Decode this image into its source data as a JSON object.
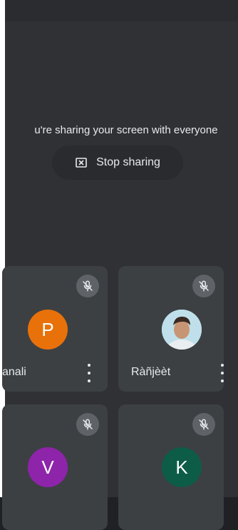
{
  "share_banner": {
    "message": "u're sharing your screen with everyone",
    "stop_button_label": "Stop sharing",
    "stop_icon": "close-box-icon"
  },
  "participants": [
    {
      "name": "anali",
      "initial": "P",
      "avatar_color": "#e8710a",
      "muted": true
    },
    {
      "name": "Ràñjèèt",
      "initial": "",
      "avatar_type": "photo",
      "muted": true
    },
    {
      "name": "",
      "initial": "V",
      "avatar_color": "#8e24aa",
      "muted": true
    },
    {
      "name": "",
      "initial": "K",
      "avatar_color": "#0d5c48",
      "muted": true
    }
  ],
  "icons": {
    "mute": "mic-off-icon",
    "more": "more-vert-icon"
  }
}
